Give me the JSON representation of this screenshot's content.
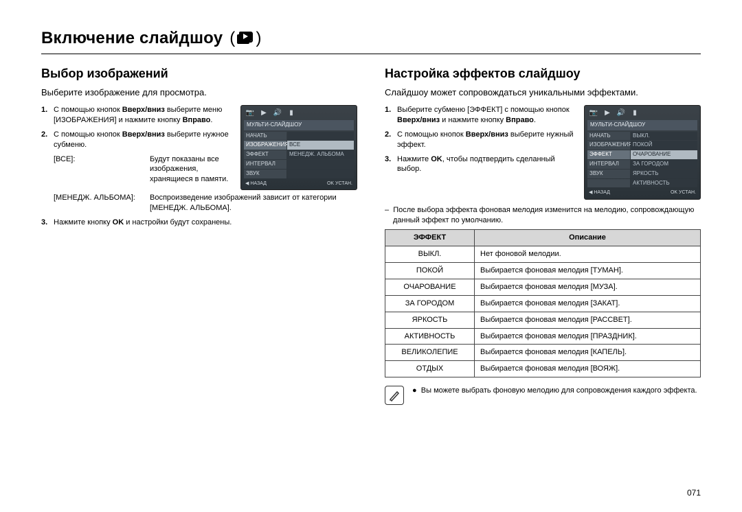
{
  "page_title": "Включение слайдшоу",
  "page_number": "071",
  "left": {
    "heading": "Выбор изображений",
    "subtitle": "Выберите изображение для просмотра.",
    "steps": [
      {
        "num": "1.",
        "html_before": "С помощью кнопок ",
        "bold1": "Вверх/вниз",
        "mid1": " выберите меню [ИЗОБРАЖЕНИЯ] и нажмите кнопку ",
        "bold2": "Вправо",
        "after": "."
      },
      {
        "num": "2.",
        "html_before": "С помощью кнопок ",
        "bold1": "Вверх/вниз",
        "mid1": " выберите нужное субменю.",
        "bold2": "",
        "after": ""
      }
    ],
    "submenus": [
      {
        "label": "[ВСЕ]:",
        "desc": "Будут показаны все изображения, хранящиеся в памяти."
      },
      {
        "label": "[МЕНЕДЖ. АЛЬБОМА]:",
        "desc": "Воспроизведение изображений зависит от категории [МЕНЕДЖ. АЛЬБОМА]."
      }
    ],
    "step3": {
      "num": "3.",
      "before": "Нажмите кнопку ",
      "bold": "OK",
      "after": " и настройки будут сохранены."
    },
    "lcd": {
      "title": "МУЛЬТИ-СЛАЙДШОУ",
      "rows": [
        {
          "l": "НАЧАТЬ",
          "r": ""
        },
        {
          "l": "ИЗОБРАЖЕНИЯ",
          "r": "ВСЕ",
          "sel": true,
          "sub": true
        },
        {
          "l": "ЭФФЕКТ",
          "r": "МЕНЕДЖ. АЛЬБОМА"
        },
        {
          "l": "ИНТЕРВАЛ",
          "r": ""
        },
        {
          "l": "ЗВУК",
          "r": ""
        }
      ],
      "back": "НАЗАД",
      "ok": "OK",
      "set": "УСТАН."
    }
  },
  "right": {
    "heading": "Настройка эффектов слайдшоу",
    "subtitle": "Слайдшоу может сопровождаться уникальными эффектами.",
    "steps": [
      {
        "num": "1.",
        "before": "Выберите субменю [ЭФФЕКТ] с помощью кнопок ",
        "bold1": "Вверх/вниз",
        "mid": " и нажмите кнопку ",
        "bold2": "Вправо",
        "after": "."
      },
      {
        "num": "2.",
        "before": "С помощью кнопок ",
        "bold1": "Вверх/вниз",
        "mid": " выберите нужный эффект.",
        "bold2": "",
        "after": ""
      },
      {
        "num": "3.",
        "before": "Нажмите ",
        "bold1": "OK",
        "mid": ", чтобы подтвердить сделанный выбор.",
        "bold2": "",
        "after": ""
      }
    ],
    "dash_note": "После выбора эффекта фоновая мелодия изменится на мелодию, сопровождающую данный эффект по умолчанию.",
    "lcd": {
      "title": "МУЛЬТИ-СЛАЙДШОУ",
      "rows": [
        {
          "l": "НАЧАТЬ",
          "r": "ВЫКЛ."
        },
        {
          "l": "ИЗОБРАЖЕНИЯ",
          "r": "ПОКОЙ"
        },
        {
          "l": "ЭФФЕКТ",
          "r": "ОЧАРОВАНИЕ",
          "sel": true,
          "sub": true
        },
        {
          "l": "ИНТЕРВАЛ",
          "r": "ЗА ГОРОДОМ"
        },
        {
          "l": "ЗВУК",
          "r": "ЯРКОСТЬ"
        },
        {
          "l": "",
          "r": "АКТИВНОСТЬ"
        }
      ],
      "back": "НАЗАД",
      "ok": "OK",
      "set": "УСТАН."
    },
    "table": {
      "head_effect": "ЭФФЕКТ",
      "head_desc": "Описание",
      "rows": [
        {
          "e": "ВЫКЛ.",
          "d": "Нет фоновой мелодии."
        },
        {
          "e": "ПОКОЙ",
          "d": "Выбирается фоновая мелодия [ТУМАН]."
        },
        {
          "e": "ОЧАРОВАНИЕ",
          "d": "Выбирается фоновая мелодия [МУЗА]."
        },
        {
          "e": "ЗА ГОРОДОМ",
          "d": "Выбирается фоновая мелодия [ЗАКАТ]."
        },
        {
          "e": "ЯРКОСТЬ",
          "d": "Выбирается фоновая мелодия [РАССВЕТ]."
        },
        {
          "e": "АКТИВНОСТЬ",
          "d": "Выбирается фоновая мелодия [ПРАЗДНИК]."
        },
        {
          "e": "ВЕЛИКОЛЕПИЕ",
          "d": "Выбирается фоновая мелодия [КАПЕЛЬ]."
        },
        {
          "e": "ОТДЫХ",
          "d": "Выбирается фоновая мелодия [ВОЯЖ]."
        }
      ]
    },
    "foot_note": "Вы можете выбрать фоновую мелодию для сопровождения каждого эффекта."
  },
  "icons": {
    "speaker": "🔊",
    "battery": "▮",
    "back_arrow": "◀",
    "paren_open": "(",
    "paren_close": ")"
  }
}
